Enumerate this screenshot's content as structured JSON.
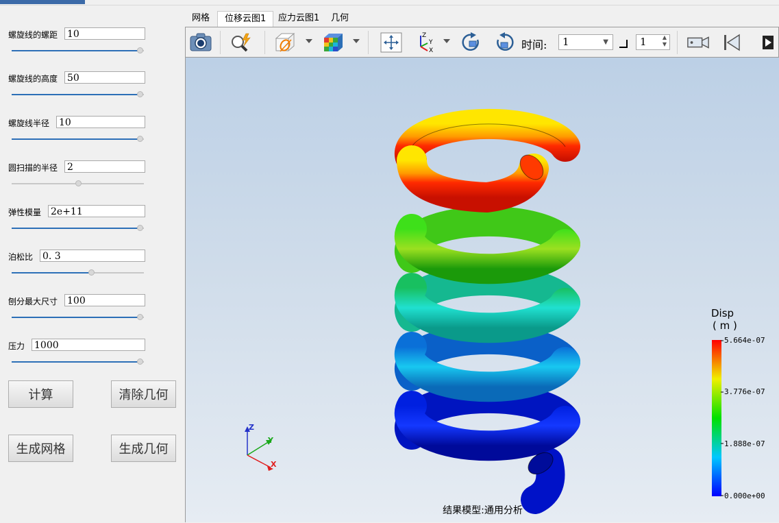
{
  "params": [
    {
      "label": "螺旋线的螺距",
      "value": "10",
      "slider": 0.97
    },
    {
      "label": "螺旋线的高度",
      "value": "50",
      "slider": 0.97
    },
    {
      "label": "螺旋线半径",
      "value": "10",
      "slider": 0.97
    },
    {
      "label": "圆扫描的半径",
      "value": "2",
      "slider": 0.5
    },
    {
      "label": "弹性模量",
      "value": "2e+11",
      "slider": 0.97
    },
    {
      "label": "泊松比",
      "value": "0. 3",
      "slider": 0.6
    },
    {
      "label": "刨分最大尺寸",
      "value": "100",
      "slider": 0.97
    },
    {
      "label": "压力",
      "value": "1000",
      "slider": 0.97
    }
  ],
  "buttons": {
    "compute": "计算",
    "clear_geometry": "清除几何",
    "generate_mesh": "生成网格",
    "generate_geometry": "生成几何"
  },
  "tabs": [
    "网格",
    "位移云图1",
    "应力云图1",
    "几何"
  ],
  "active_tab": 1,
  "toolbar": {
    "time_label": "时间:",
    "time_value": "1",
    "step_value": "1",
    "icons": [
      "camera-icon",
      "zoom-icon",
      "clip-box-icon",
      "color-cube-icon",
      "fit-view-icon",
      "axes-orientation-icon",
      "rotate-cw-icon",
      "rotate-ccw-icon",
      "video-record-icon",
      "skip-first-icon",
      "next-frame-icon"
    ]
  },
  "legend": {
    "title": "Disp",
    "unit": "( m )",
    "max": "5.664e-07",
    "v2": "3.776e-07",
    "v1": "1.888e-07",
    "min": "0.000e+00"
  },
  "axes": {
    "x": "X",
    "y": "Y",
    "z": "Z"
  },
  "caption": "结果模型:通用分析",
  "colors": {
    "accent": "#2c6fb7",
    "coil_red": "#ff1a00",
    "coil_blue": "#0010c8"
  }
}
